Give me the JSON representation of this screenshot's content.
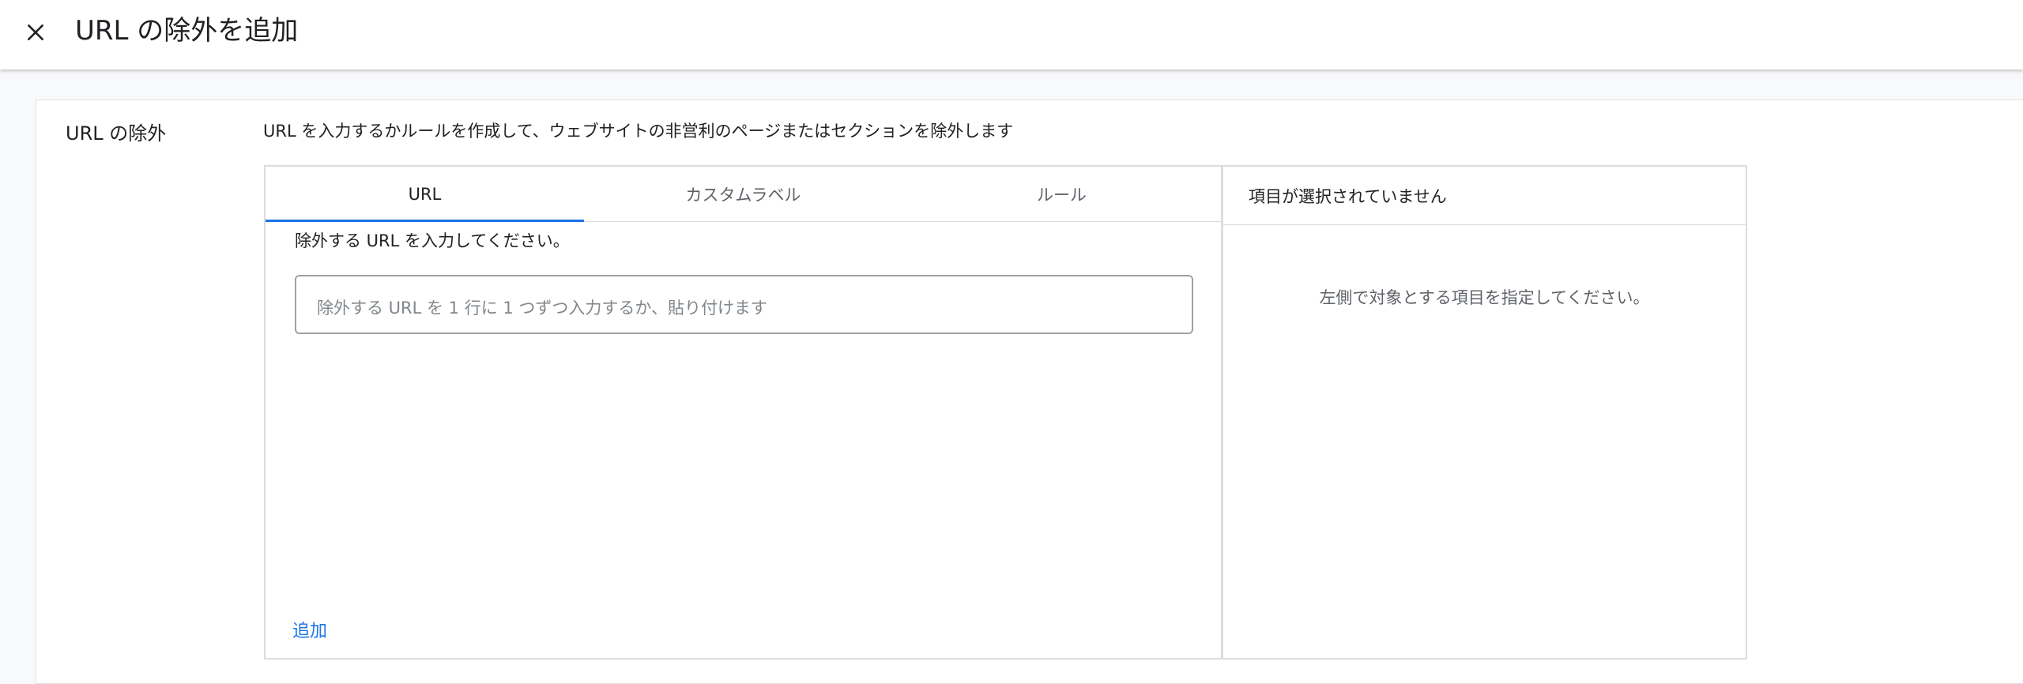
{
  "header": {
    "title": "URL の除外を追加",
    "close_icon": "close-icon"
  },
  "section": {
    "label": "URL の除外",
    "description": "URL を入力するかルールを作成して、ウェブサイトの非営利のページまたはセクションを除外します"
  },
  "tabs": [
    {
      "label": "URL",
      "active": true
    },
    {
      "label": "カスタムラベル",
      "active": false
    },
    {
      "label": "ルール",
      "active": false
    }
  ],
  "url_input": {
    "label": "除外する URL を入力してください。",
    "placeholder": "除外する URL を 1 行に 1 つずつ入力するか、貼り付けます",
    "value": ""
  },
  "add_label": "追加",
  "selection": {
    "header": "項目が選択されていません",
    "empty_message": "左側で対象とする項目を指定してください。"
  },
  "colors": {
    "accent": "#1a73e8",
    "border": "#dadce0",
    "text": "#202124",
    "muted": "#5f6368"
  }
}
